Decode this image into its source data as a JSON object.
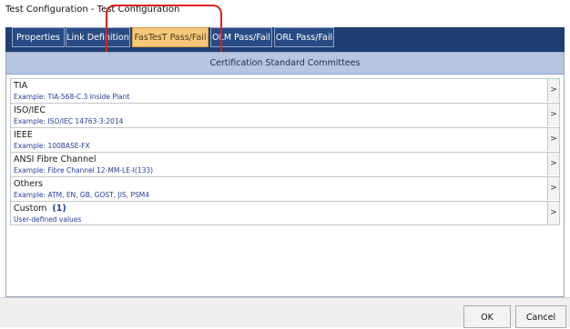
{
  "window": {
    "title": "Test Configuration - Test Configuration"
  },
  "tabs": [
    {
      "label": "Properties",
      "active": false
    },
    {
      "label": "Link Definition",
      "active": false
    },
    {
      "label": "FasTesT Pass/Fail",
      "active": true
    },
    {
      "label": "OLM Pass/Fail",
      "active": false
    },
    {
      "label": "ORL Pass/Fail",
      "active": false
    }
  ],
  "section": {
    "header": "Certification Standard Committees"
  },
  "rows": [
    {
      "title": "TIA",
      "subtitle": "Example: TIA-568-C.3 Inside Plant",
      "chevron": ">"
    },
    {
      "title": "ISO/IEC",
      "subtitle": "Example: ISO/IEC 14763-3:2014",
      "chevron": ">"
    },
    {
      "title": "IEEE",
      "subtitle": "Example: 100BASE-FX",
      "chevron": ">"
    },
    {
      "title": "ANSI Fibre Channel",
      "subtitle": "Example: Fibre Channel 12-MM-LE-I(133)",
      "chevron": ">"
    },
    {
      "title": "Others",
      "subtitle": "Example: ATM, EN, GB, GOST, JIS, PSM4",
      "chevron": ">"
    },
    {
      "title": "Custom",
      "badge": "(1)",
      "subtitle": "User-defined values",
      "chevron": ">"
    }
  ],
  "footer": {
    "ok_label": "OK",
    "cancel_label": "Cancel"
  },
  "colors": {
    "tab_strip": "#1f3f72",
    "active_tab": "#f5c77a",
    "section_header": "#b6c6e2",
    "subtitle_text": "#243f99",
    "highlight": "#e02020"
  }
}
